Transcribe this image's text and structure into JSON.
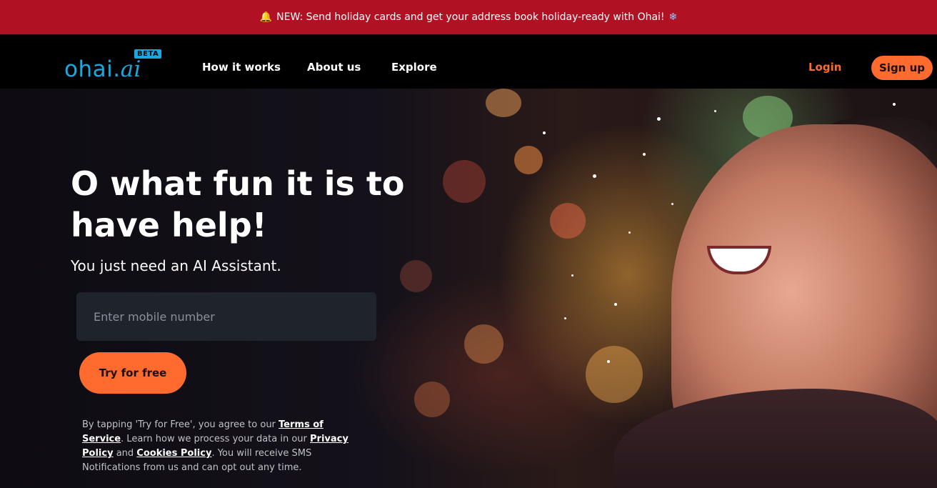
{
  "announcement": {
    "bell_icon": "🔔",
    "text": "NEW: Send holiday cards and get your address book holiday-ready with Ohai!",
    "snowflake_icon": "❄"
  },
  "nav": {
    "logo_main": "ohai.",
    "logo_ai": "ai",
    "beta": "BETA",
    "links": [
      "How it works",
      "About us",
      "Explore"
    ],
    "login": "Login",
    "signup": "Sign up"
  },
  "hero": {
    "headline": "O what fun it is to have help!",
    "subhead": "You just need an AI Assistant.",
    "phone_placeholder": "Enter mobile number",
    "cta": "Try for free",
    "legal": {
      "part1": "By tapping 'Try for Free', you agree to our ",
      "terms": "Terms of Service",
      "part2": ". Learn how we process your data in our ",
      "privacy": "Privacy Policy",
      "part3": " and ",
      "cookies": "Cookies Policy",
      "part4": ". You will receive SMS Notifications from us and can opt out any time."
    }
  },
  "colors": {
    "accent": "#ff6a2e",
    "brand": "#19a8e0",
    "banner": "#b01224"
  }
}
